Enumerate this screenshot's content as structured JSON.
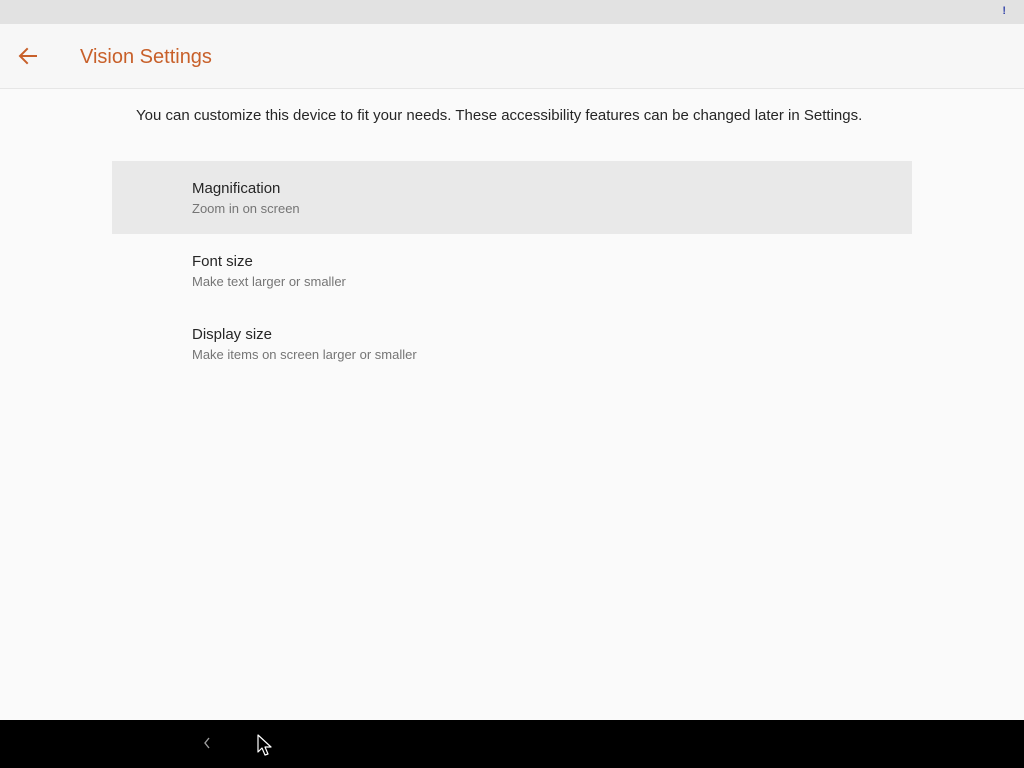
{
  "status_bar": {
    "indicator": "!"
  },
  "header": {
    "title": "Vision Settings",
    "back_icon": "arrow-left-icon"
  },
  "description": "You can customize this device to fit your needs. These accessibility features can be changed later in Settings.",
  "settings": [
    {
      "title": "Magnification",
      "subtitle": "Zoom in on screen",
      "selected": true
    },
    {
      "title": "Font size",
      "subtitle": "Make text larger or smaller",
      "selected": false
    },
    {
      "title": "Display size",
      "subtitle": "Make items on screen larger or smaller",
      "selected": false
    }
  ],
  "nav_bar": {
    "back_icon": "chevron-left-icon"
  },
  "colors": {
    "accent": "#c8602a",
    "background": "#fafafa",
    "selected_row": "#e9e9e9",
    "nav_bar": "#000000"
  }
}
